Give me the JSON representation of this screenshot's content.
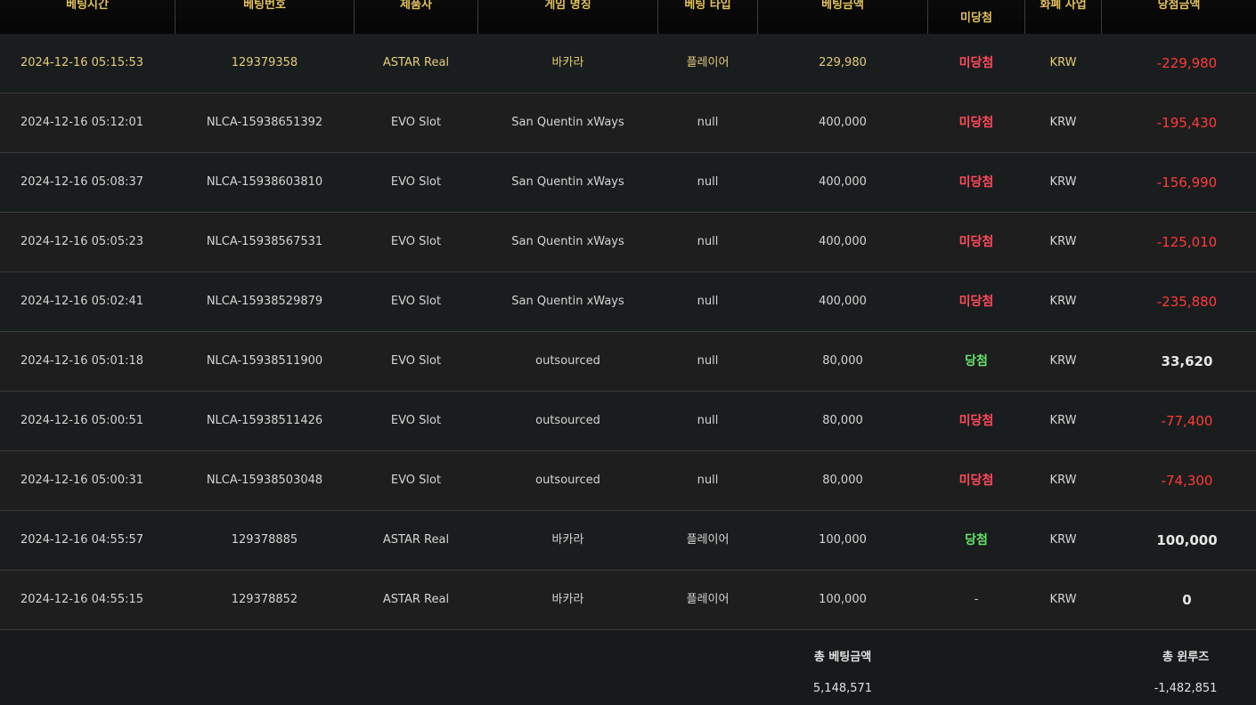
{
  "columns": {
    "bet_time": "베팅시간",
    "bet_number": "베팅번호",
    "provider": "제품사",
    "game_name": "게임 명칭",
    "bet_type": "베팅 타입",
    "bet_amount": "베팅금액",
    "result": "미당첨",
    "currency": "화폐 사업",
    "win_amount": "당첨금액"
  },
  "rows": [
    {
      "time": "2024-12-16 05:15:53",
      "number": "129379358",
      "provider": "ASTAR Real",
      "game": "바카라",
      "type": "플레이어",
      "amount": "229,980",
      "result": "미당첨",
      "currency": "KRW",
      "win": "-229,980"
    },
    {
      "time": "2024-12-16 05:12:01",
      "number": "NLCA-15938651392",
      "provider": "EVO Slot",
      "game": "San Quentin xWays",
      "type": "null",
      "amount": "400,000",
      "result": "미당첨",
      "currency": "KRW",
      "win": "-195,430"
    },
    {
      "time": "2024-12-16 05:08:37",
      "number": "NLCA-15938603810",
      "provider": "EVO Slot",
      "game": "San Quentin xWays",
      "type": "null",
      "amount": "400,000",
      "result": "미당첨",
      "currency": "KRW",
      "win": "-156,990"
    },
    {
      "time": "2024-12-16 05:05:23",
      "number": "NLCA-15938567531",
      "provider": "EVO Slot",
      "game": "San Quentin xWays",
      "type": "null",
      "amount": "400,000",
      "result": "미당첨",
      "currency": "KRW",
      "win": "-125,010"
    },
    {
      "time": "2024-12-16 05:02:41",
      "number": "NLCA-15938529879",
      "provider": "EVO Slot",
      "game": "San Quentin xWays",
      "type": "null",
      "amount": "400,000",
      "result": "미당첨",
      "currency": "KRW",
      "win": "-235,880"
    },
    {
      "time": "2024-12-16 05:01:18",
      "number": "NLCA-15938511900",
      "provider": "EVO Slot",
      "game": "outsourced",
      "type": "null",
      "amount": "80,000",
      "result": "당첨",
      "currency": "KRW",
      "win": "33,620"
    },
    {
      "time": "2024-12-16 05:00:51",
      "number": "NLCA-15938511426",
      "provider": "EVO Slot",
      "game": "outsourced",
      "type": "null",
      "amount": "80,000",
      "result": "미당첨",
      "currency": "KRW",
      "win": "-77,400"
    },
    {
      "time": "2024-12-16 05:00:31",
      "number": "NLCA-15938503048",
      "provider": "EVO Slot",
      "game": "outsourced",
      "type": "null",
      "amount": "80,000",
      "result": "미당첨",
      "currency": "KRW",
      "win": "-74,300"
    },
    {
      "time": "2024-12-16 04:55:57",
      "number": "129378885",
      "provider": "ASTAR Real",
      "game": "바카라",
      "type": "플레이어",
      "amount": "100,000",
      "result": "당첨",
      "currency": "KRW",
      "win": "100,000"
    },
    {
      "time": "2024-12-16 04:55:15",
      "number": "129378852",
      "provider": "ASTAR Real",
      "game": "바카라",
      "type": "플레이어",
      "amount": "100,000",
      "result": "-",
      "currency": "KRW",
      "win": "0"
    }
  ],
  "footer": {
    "total_bet_label": "총 베팅금액",
    "total_bet_value": "5,148,571",
    "total_winloss_label": "총 윈루즈",
    "total_winloss_value": "-1,482,851"
  }
}
